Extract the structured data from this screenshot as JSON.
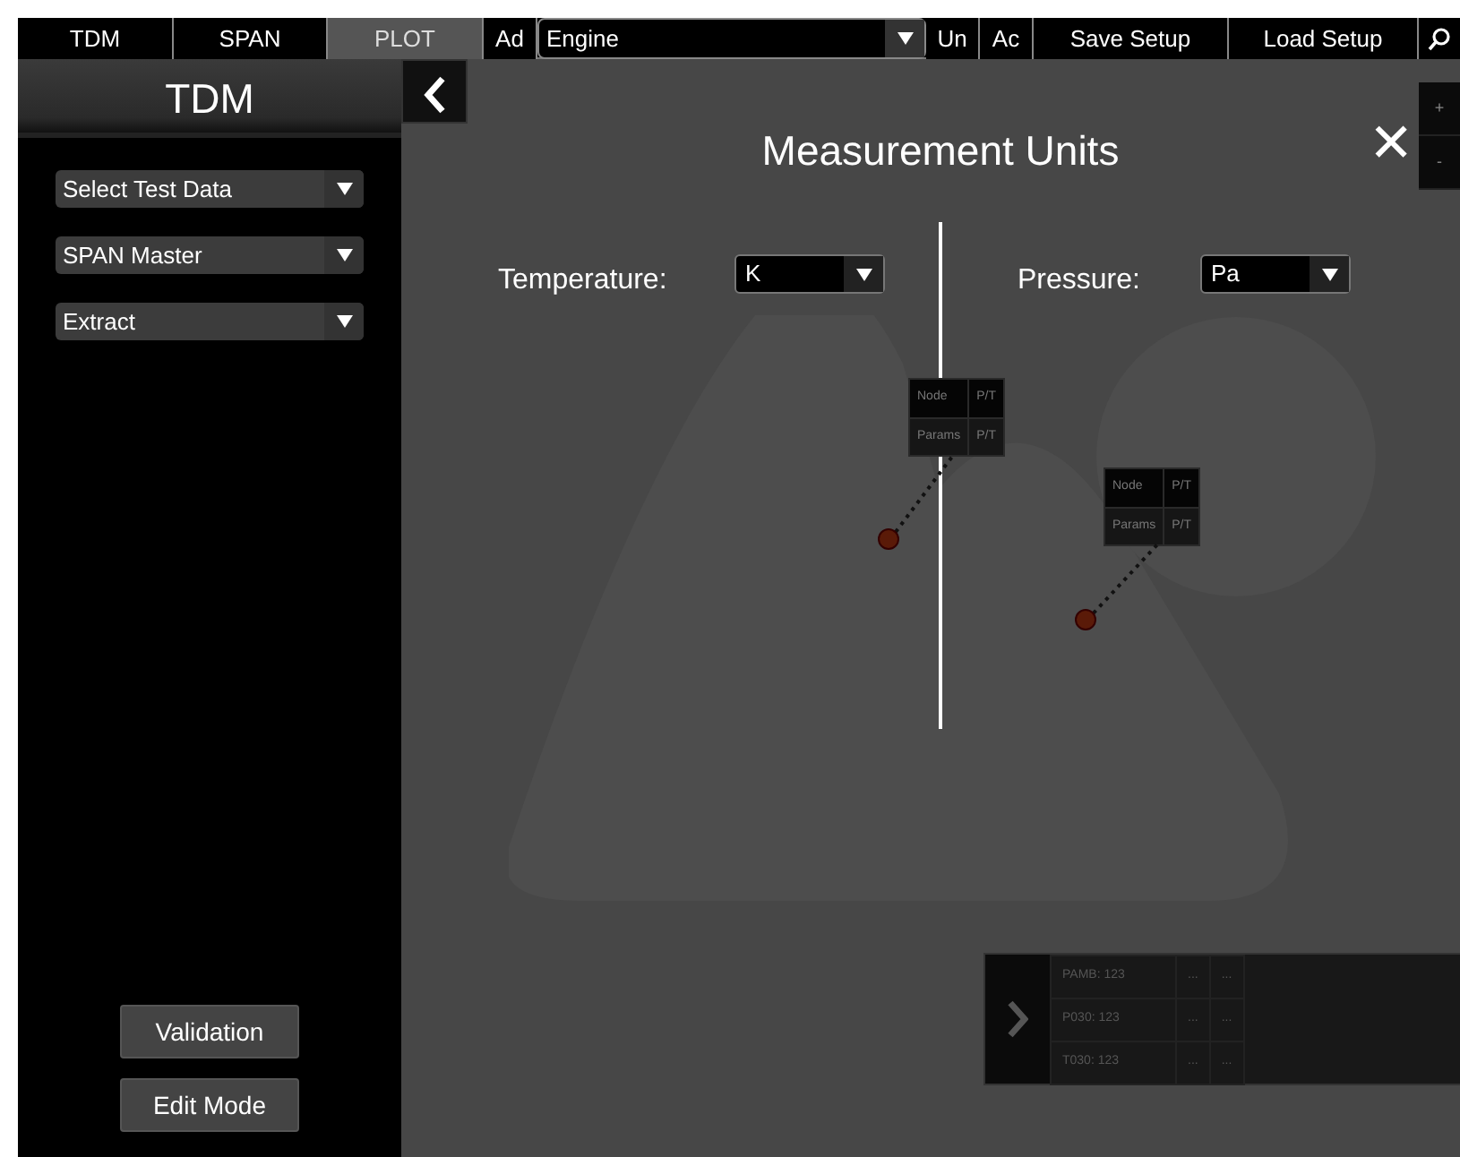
{
  "top_nav": {
    "tabs": [
      {
        "label": "TDM",
        "selected": false
      },
      {
        "label": "SPAN",
        "selected": false
      },
      {
        "label": "PLOT",
        "selected": true
      },
      {
        "label": "Ad",
        "selected": false
      }
    ],
    "engine_select": {
      "value": "Engine"
    },
    "buttons": [
      "Un",
      "Ac",
      "Save Setup",
      "Load Setup"
    ]
  },
  "sidebar": {
    "title": "TDM",
    "dropdowns": [
      "Select Test Data",
      "SPAN Master",
      "Extract"
    ],
    "buttons": [
      "Validation",
      "Edit Mode"
    ]
  },
  "canvas": {
    "nodes": [
      {
        "rows": [
          [
            "Node",
            "P/T"
          ],
          [
            "Params",
            "P/T"
          ]
        ]
      },
      {
        "rows": [
          [
            "Node",
            "P/T"
          ],
          [
            "Params",
            "P/T"
          ]
        ]
      }
    ],
    "zoom": [
      "+",
      "-"
    ],
    "readout": [
      [
        "PAMB: 123",
        "...",
        "..."
      ],
      [
        "P030: 123",
        "...",
        "..."
      ],
      [
        "T030: 123",
        "...",
        "..."
      ]
    ]
  },
  "modal": {
    "title": "Measurement Units",
    "close": "✕",
    "fields": [
      {
        "label": "Temperature:",
        "value": "K"
      },
      {
        "label": "Pressure:",
        "value": "Pa"
      }
    ]
  }
}
